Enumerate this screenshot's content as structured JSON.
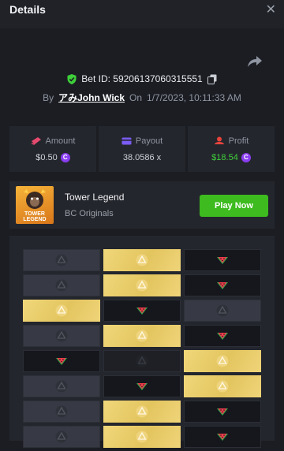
{
  "header": {
    "title": "Details",
    "close_glyph": "✕"
  },
  "bet": {
    "id_text": "Bet ID: 59206137060315551",
    "by_label": "By",
    "user": "アみJohn Wick",
    "on_label": "On",
    "date": "1/7/2023, 10:11:33 AM"
  },
  "stats": {
    "amount_label": "Amount",
    "amount_value": "$0.50",
    "payout_label": "Payout",
    "payout_value": "38.0586 x",
    "profit_label": "Profit",
    "profit_value": "$18.54",
    "coin_glyph": "C"
  },
  "game": {
    "name": "Tower Legend",
    "provider": "BC Originals",
    "play_label": "Play Now",
    "thumb_text_1": "TOWER",
    "thumb_text_2": "LEGEND"
  },
  "board": {
    "rows": [
      [
        "safe-dim",
        "safe-gold",
        "mine"
      ],
      [
        "safe-dim",
        "safe-gold",
        "mine"
      ],
      [
        "safe-gold",
        "mine",
        "safe-dim"
      ],
      [
        "safe-dim",
        "safe-gold",
        "mine"
      ],
      [
        "mine",
        "empty",
        "safe-gold"
      ],
      [
        "safe-dim",
        "mine",
        "safe-gold"
      ],
      [
        "safe-dim",
        "safe-gold",
        "mine"
      ],
      [
        "safe-dim",
        "safe-gold",
        "mine"
      ]
    ]
  },
  "colors": {
    "background": "#1b1d23",
    "panel": "#24262d",
    "accent_green": "#3dbb1f",
    "profit_green": "#3ecf3a",
    "coin_purple": "#8a3df0",
    "gold": "#e8cc66"
  }
}
